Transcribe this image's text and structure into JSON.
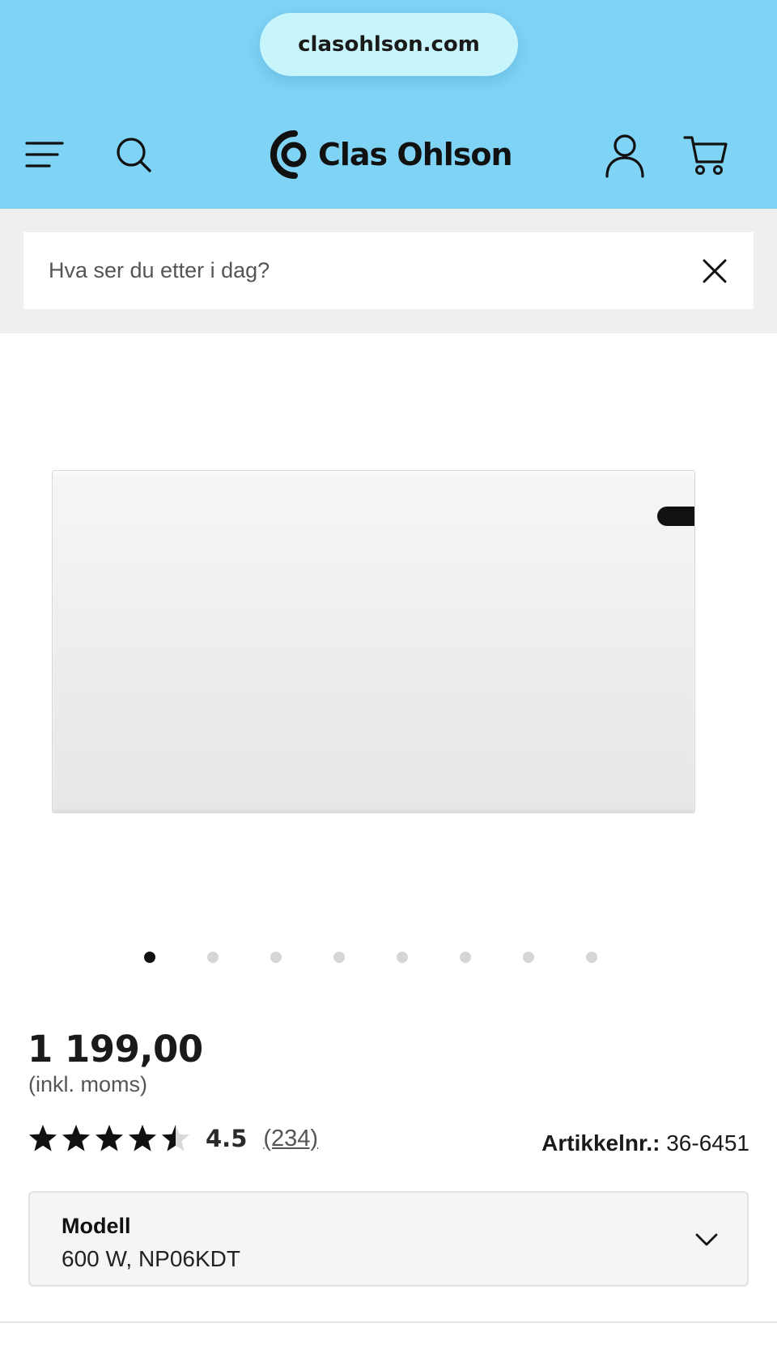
{
  "browser": {
    "url": "clasohlson.com"
  },
  "header": {
    "brand": "Clas Ohlson",
    "icons": [
      "menu-icon",
      "search-icon",
      "clas-ohlson-logo-icon",
      "account-icon",
      "cart-icon"
    ],
    "background_color": "#7fd3f5"
  },
  "search": {
    "placeholder": "Hva ser du etter i dag?",
    "value": ""
  },
  "gallery": {
    "slide_count": 8,
    "active_slide": 1
  },
  "product": {
    "price": "1 199,00",
    "vat_note": "(inkl. moms)",
    "rating": {
      "stars": 4.5,
      "value": "4.5",
      "count": "(234)"
    },
    "sku": {
      "label": "Artikkelnr.:",
      "value": "36-6451"
    },
    "variant": {
      "label": "Modell",
      "value": "600 W, NP06KDT"
    }
  }
}
